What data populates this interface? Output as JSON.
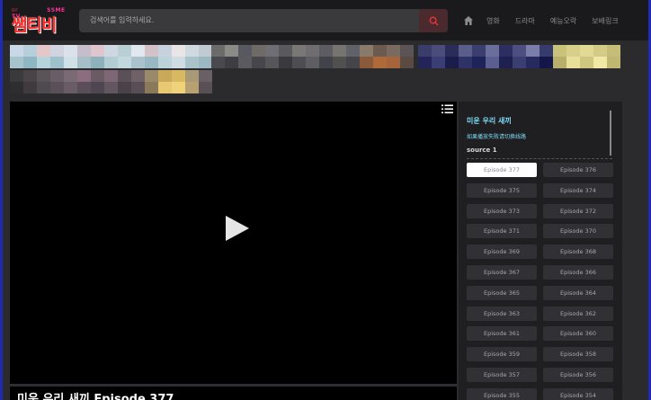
{
  "header": {
    "logo_small": "or",
    "logo_tag": "SSME TV",
    "logo_text": "쌤티비",
    "search_placeholder": "검색어를 입력하세요.",
    "nav": [
      {
        "label": "영화"
      },
      {
        "label": "드라마"
      },
      {
        "label": "예능오락"
      },
      {
        "label": "보배링크"
      }
    ]
  },
  "player": {
    "title": "미운 우리 새끼 Episode 377"
  },
  "sidebar": {
    "title": "미운 우리 새끼",
    "subtitle": "如果播放失败请切换线路",
    "source": "source 1",
    "episodes": [
      "Episode 377",
      "Episode 376",
      "Episode 375",
      "Episode 374",
      "Episode 373",
      "Episode 372",
      "Episode 371",
      "Episode 370",
      "Episode 369",
      "Episode 368",
      "Episode 367",
      "Episode 366",
      "Episode 365",
      "Episode 364",
      "Episode 363",
      "Episode 362",
      "Episode 361",
      "Episode 360",
      "Episode 359",
      "Episode 358",
      "Episode 357",
      "Episode 356",
      "Episode 355",
      "Episode 354"
    ],
    "active_episode": "Episode 377"
  },
  "colors": {
    "accent": "#7fdcf5",
    "brand_red": "#ff2a2a",
    "search_icon": "#e2333a"
  }
}
